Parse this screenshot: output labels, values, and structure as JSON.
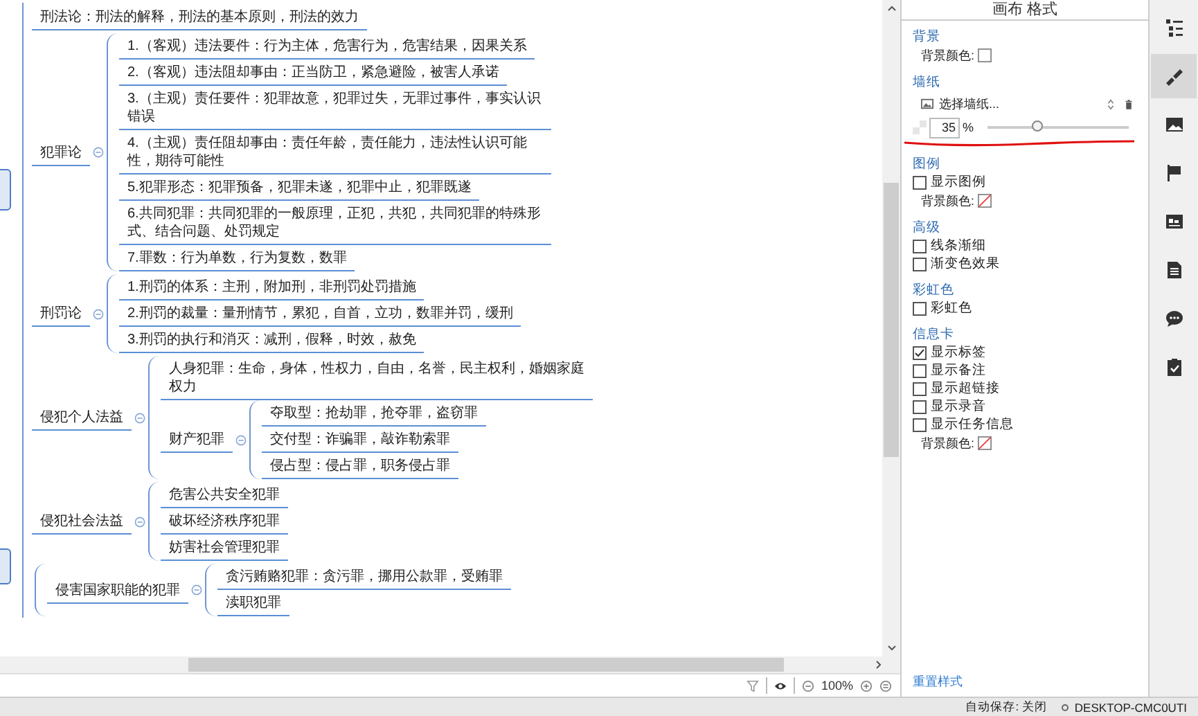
{
  "canvas": {
    "branches": [
      {
        "label": "刑法论：刑法的解释，刑法的基本原则，刑法的效力"
      },
      {
        "label": "犯罪论",
        "children": [
          {
            "label": "1.（客观）违法要件：行为主体，危害行为，危害结果，因果关系"
          },
          {
            "label": "2.（客观）违法阻却事由：正当防卫，紧急避险，被害人承诺"
          },
          {
            "label": "3.（主观）责任要件：犯罪故意，犯罪过失，无罪过事件，事实认识错误"
          },
          {
            "label": "4.（主观）责任阻却事由：责任年龄，责任能力，违法性认识可能性，期待可能性"
          },
          {
            "label": "5.犯罪形态：犯罪预备，犯罪未遂，犯罪中止，犯罪既遂"
          },
          {
            "label": "6.共同犯罪：共同犯罪的一般原理，正犯，共犯，共同犯罪的特殊形式、结合问题、处罚规定"
          },
          {
            "label": "7.罪数：行为单数，行为复数，数罪"
          }
        ]
      },
      {
        "label": "刑罚论",
        "children": [
          {
            "label": "1.刑罚的体系：主刑，附加刑，非刑罚处罚措施"
          },
          {
            "label": "2.刑罚的裁量：量刑情节，累犯，自首，立功，数罪并罚，缓刑"
          },
          {
            "label": "3.刑罚的执行和消灭：减刑，假释，时效，赦免"
          }
        ]
      },
      {
        "label": "侵犯个人法益",
        "children": [
          {
            "label": "人身犯罪：生命，身体，性权力，自由，名誉，民主权利，婚姻家庭权力"
          },
          {
            "label": "财产犯罪",
            "children": [
              {
                "label": "夺取型：抢劫罪，抢夺罪，盗窃罪"
              },
              {
                "label": "交付型：诈骗罪，敲诈勒索罪"
              },
              {
                "label": "侵占型：侵占罪，职务侵占罪"
              }
            ]
          }
        ]
      },
      {
        "label": "侵犯社会法益",
        "children": [
          {
            "label": "危害公共安全犯罪"
          },
          {
            "label": "破坏经济秩序犯罪"
          },
          {
            "label": "妨害社会管理犯罪"
          }
        ]
      },
      {
        "children": [
          {
            "label": "侵害国家职能的犯罪",
            "children": [
              {
                "label": "贪污贿赂犯罪：贪污罪，挪用公款罪，受贿罪"
              },
              {
                "label": "渎职犯罪"
              }
            ]
          }
        ]
      }
    ]
  },
  "zoom_bar": {
    "zoom": "100%"
  },
  "panel": {
    "title": "画布 格式",
    "sections": [
      {
        "heading": "背景",
        "rows": [
          {
            "kind": "color",
            "label": "背景颜色:",
            "no_color": false
          }
        ]
      },
      {
        "heading": "墙纸",
        "rows": [
          {
            "kind": "select",
            "value": "选择墙纸..."
          },
          {
            "kind": "slider",
            "value": "35",
            "unit": "%",
            "level": 0.35
          }
        ]
      },
      {
        "heading": "图例",
        "rows": [
          {
            "kind": "checkbox",
            "label": "显示图例",
            "checked": false
          },
          {
            "kind": "color",
            "label": "背景颜色:",
            "no_color": true
          }
        ]
      },
      {
        "heading": "高级",
        "rows": [
          {
            "kind": "checkbox",
            "label": "线条渐细",
            "checked": false
          },
          {
            "kind": "checkbox",
            "label": "渐变色效果",
            "checked": false
          }
        ]
      },
      {
        "heading": "彩虹色",
        "rows": [
          {
            "kind": "checkbox",
            "label": "彩虹色",
            "checked": false
          }
        ]
      },
      {
        "heading": "信息卡",
        "rows": [
          {
            "kind": "checkbox",
            "label": "显示标签",
            "checked": true
          },
          {
            "kind": "checkbox",
            "label": "显示备注",
            "checked": false
          },
          {
            "kind": "checkbox",
            "label": "显示超链接",
            "checked": false
          },
          {
            "kind": "checkbox",
            "label": "显示录音",
            "checked": false
          },
          {
            "kind": "checkbox",
            "label": "显示任务信息",
            "checked": false
          },
          {
            "kind": "color",
            "label": "背景颜色:",
            "no_color": true
          }
        ]
      }
    ],
    "reset_link": "重置样式"
  },
  "toolbar": [
    {
      "selected": false
    },
    {
      "selected": true
    },
    {
      "selected": false
    },
    {
      "selected": false
    },
    {
      "selected": false
    },
    {
      "selected": false
    },
    {
      "selected": false
    },
    {
      "selected": false
    }
  ],
  "status_bar": {
    "autosave": "自动保存: 关闭",
    "computer": "DESKTOP-CMC0UTI"
  }
}
